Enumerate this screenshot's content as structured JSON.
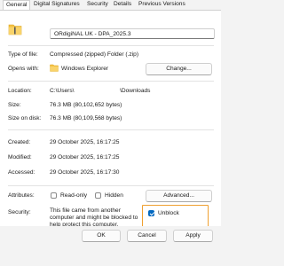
{
  "tabs": [
    {
      "label": "General"
    },
    {
      "label": "Digital Signatures"
    },
    {
      "label": "Security"
    },
    {
      "label": "Details"
    },
    {
      "label": "Previous Versions"
    }
  ],
  "file": {
    "name": "ORdigiNAL UK - DPA_2025.3"
  },
  "type_of_file": {
    "label": "Type of file:",
    "value": "Compressed (zipped) Folder (.zip)"
  },
  "opens_with": {
    "label": "Opens with:",
    "value": "Windows Explorer",
    "change_label": "Change..."
  },
  "location": {
    "label": "Location:",
    "value_start": "C:\\Users\\",
    "value_end": "\\Downloads"
  },
  "size": {
    "label": "Size:",
    "value": "76.3 MB (80,102,652 bytes)"
  },
  "size_on_disk": {
    "label": "Size on disk:",
    "value": "76.3 MB (80,109,568 bytes)"
  },
  "created": {
    "label": "Created:",
    "value": "29 October 2025, 16:17:25"
  },
  "modified": {
    "label": "Modified:",
    "value": "29 October 2025, 16:17:25"
  },
  "accessed": {
    "label": "Accessed:",
    "value": "29 October 2025, 16:17:30"
  },
  "attributes": {
    "label": "Attributes:",
    "readonly_label": "Read-only",
    "hidden_label": "Hidden",
    "advanced_label": "Advanced...",
    "readonly_checked": false,
    "hidden_checked": false
  },
  "security": {
    "label": "Security:",
    "message_lines": [
      "This file came from another",
      "computer and might be blocked to",
      "help protect this computer."
    ],
    "unblock_label": "Unblock",
    "unblock_checked": true
  },
  "footer": {
    "ok_label": "OK",
    "cancel_label": "Cancel",
    "apply_label": "Apply"
  },
  "colors": {
    "accent": "#0067c0",
    "highlight": "#f0a030",
    "folder": "#f5c242"
  },
  "icons": {
    "file": "zip-folder-icon",
    "opens_with": "windows-explorer-icon"
  }
}
